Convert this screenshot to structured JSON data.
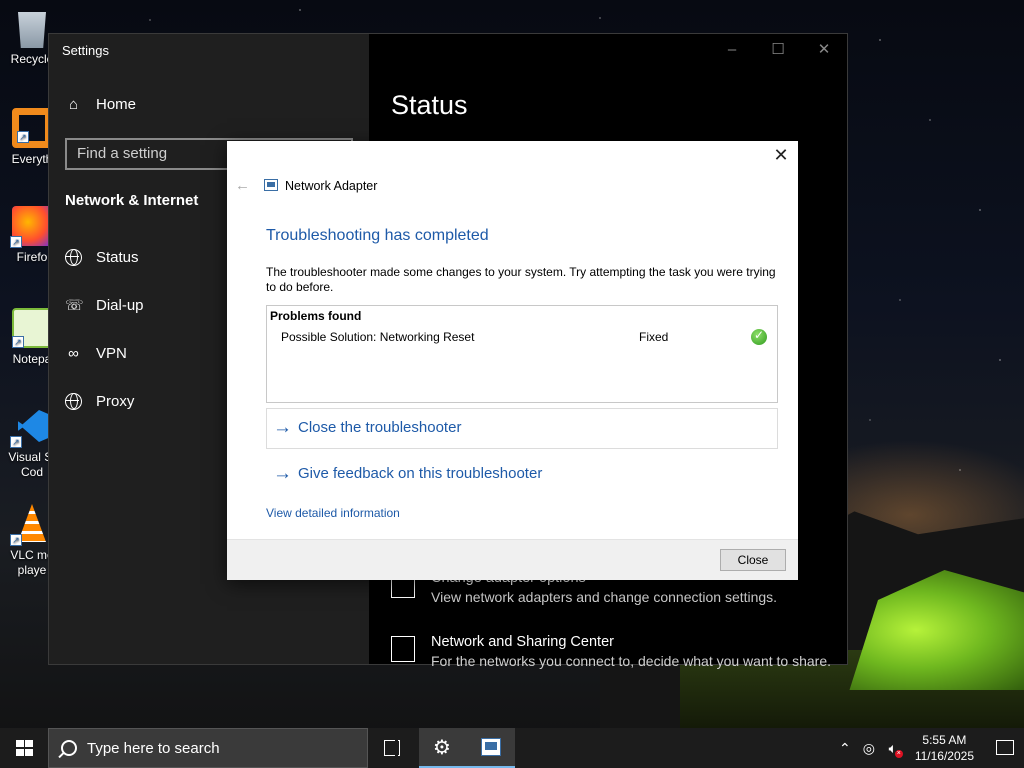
{
  "desktop": {
    "icons": [
      {
        "label": "Recycle",
        "icon": "recycle-bin-icon"
      },
      {
        "label": "Everyth",
        "icon": "everything-icon"
      },
      {
        "label": "Firefo",
        "icon": "firefox-icon"
      },
      {
        "label": "Notepa",
        "icon": "notepad-plus-plus-icon"
      },
      {
        "label": "Visual St Cod",
        "icon": "vscode-icon"
      },
      {
        "label": "VLC me playe",
        "icon": "vlc-icon"
      }
    ]
  },
  "settings": {
    "title": "Settings",
    "home_label": "Home",
    "search_placeholder": "Find a setting",
    "section_title": "Network & Internet",
    "nav": [
      {
        "label": "Status",
        "icon": "globe-icon"
      },
      {
        "label": "Dial-up",
        "icon": "dialup-icon"
      },
      {
        "label": "VPN",
        "icon": "vpn-icon"
      },
      {
        "label": "Proxy",
        "icon": "globe-icon"
      }
    ],
    "page_title": "Status",
    "items": [
      {
        "title": "Change adapter options",
        "desc": "View network adapters and change connection settings.",
        "icon": "adapter-icon"
      },
      {
        "title": "Network and Sharing Center",
        "desc": "For the networks you connect to, decide what you want to share.",
        "icon": "sharing-center-icon"
      }
    ]
  },
  "dialog": {
    "app_title": "Network Adapter",
    "heading": "Troubleshooting has completed",
    "message": "The troubleshooter made some changes to your system. Try attempting the task you were trying to do before.",
    "problems_header": "Problems found",
    "problem": {
      "name": "Possible Solution: Networking Reset",
      "status": "Fixed"
    },
    "close_link": "Close the troubleshooter",
    "feedback_link": "Give feedback on this troubleshooter",
    "details_link": "View detailed information",
    "close_button": "Close"
  },
  "taskbar": {
    "search_placeholder": "Type here to search",
    "time": "5:55 AM",
    "date": "11/16/2025"
  }
}
